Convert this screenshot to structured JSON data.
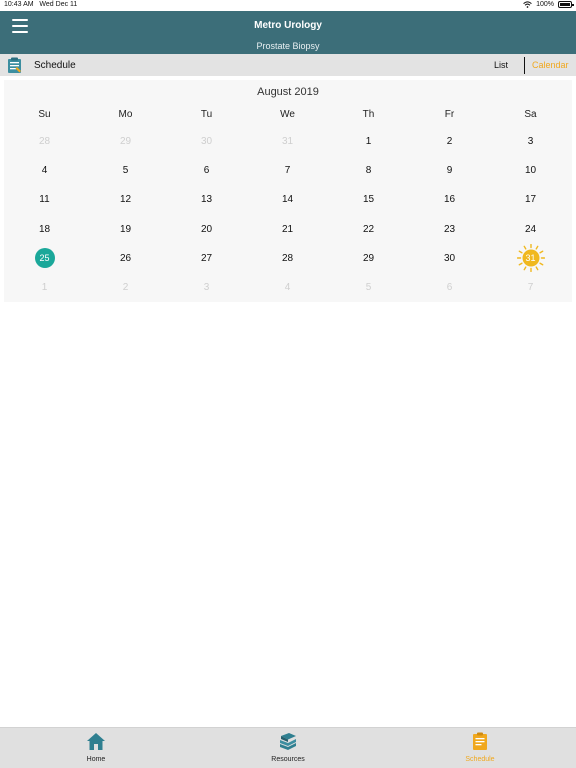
{
  "status_bar": {
    "time": "10:43 AM",
    "date": "Wed Dec 11",
    "battery": "100%"
  },
  "header": {
    "title": "Metro Urology",
    "subtitle": "Prostate Biopsy",
    "menu_icon": "hamburger-menu-icon"
  },
  "sub_header": {
    "title": "Schedule",
    "icon": "schedule-clipboard-icon",
    "list_label": "List",
    "calendar_label": "Calendar"
  },
  "calendar": {
    "month_label": "August 2019",
    "weekdays": [
      "Su",
      "Mo",
      "Tu",
      "We",
      "Th",
      "Fr",
      "Sa"
    ],
    "weeks": [
      [
        {
          "d": "28",
          "muted": true
        },
        {
          "d": "29",
          "muted": true
        },
        {
          "d": "30",
          "muted": true
        },
        {
          "d": "31",
          "muted": true
        },
        {
          "d": "1"
        },
        {
          "d": "2"
        },
        {
          "d": "3"
        }
      ],
      [
        {
          "d": "4"
        },
        {
          "d": "5"
        },
        {
          "d": "6"
        },
        {
          "d": "7"
        },
        {
          "d": "8"
        },
        {
          "d": "9"
        },
        {
          "d": "10"
        }
      ],
      [
        {
          "d": "11"
        },
        {
          "d": "12"
        },
        {
          "d": "13"
        },
        {
          "d": "14"
        },
        {
          "d": "15"
        },
        {
          "d": "16"
        },
        {
          "d": "17"
        }
      ],
      [
        {
          "d": "18"
        },
        {
          "d": "19"
        },
        {
          "d": "20"
        },
        {
          "d": "21"
        },
        {
          "d": "22"
        },
        {
          "d": "23"
        },
        {
          "d": "24"
        }
      ],
      [
        {
          "d": "25",
          "today": true
        },
        {
          "d": "26"
        },
        {
          "d": "27"
        },
        {
          "d": "28"
        },
        {
          "d": "29"
        },
        {
          "d": "30"
        },
        {
          "d": "31",
          "marked": true
        }
      ],
      [
        {
          "d": "1",
          "muted": true
        },
        {
          "d": "2",
          "muted": true
        },
        {
          "d": "3",
          "muted": true
        },
        {
          "d": "4",
          "muted": true
        },
        {
          "d": "5",
          "muted": true
        },
        {
          "d": "6",
          "muted": true
        },
        {
          "d": "7",
          "muted": true
        }
      ]
    ],
    "today_color": "#1ba89a",
    "marker_color": "#f0b81e",
    "marker_icon": "sun-icon"
  },
  "tab_bar": {
    "tabs": [
      {
        "label": "Home",
        "icon": "home-icon",
        "active": false
      },
      {
        "label": "Resources",
        "icon": "books-icon",
        "active": false
      },
      {
        "label": "Schedule",
        "icon": "schedule-clipboard-icon",
        "active": true
      }
    ]
  },
  "colors": {
    "header_bg": "#3c6e79",
    "accent": "#f0a81e",
    "teal": "#1ba89a"
  }
}
